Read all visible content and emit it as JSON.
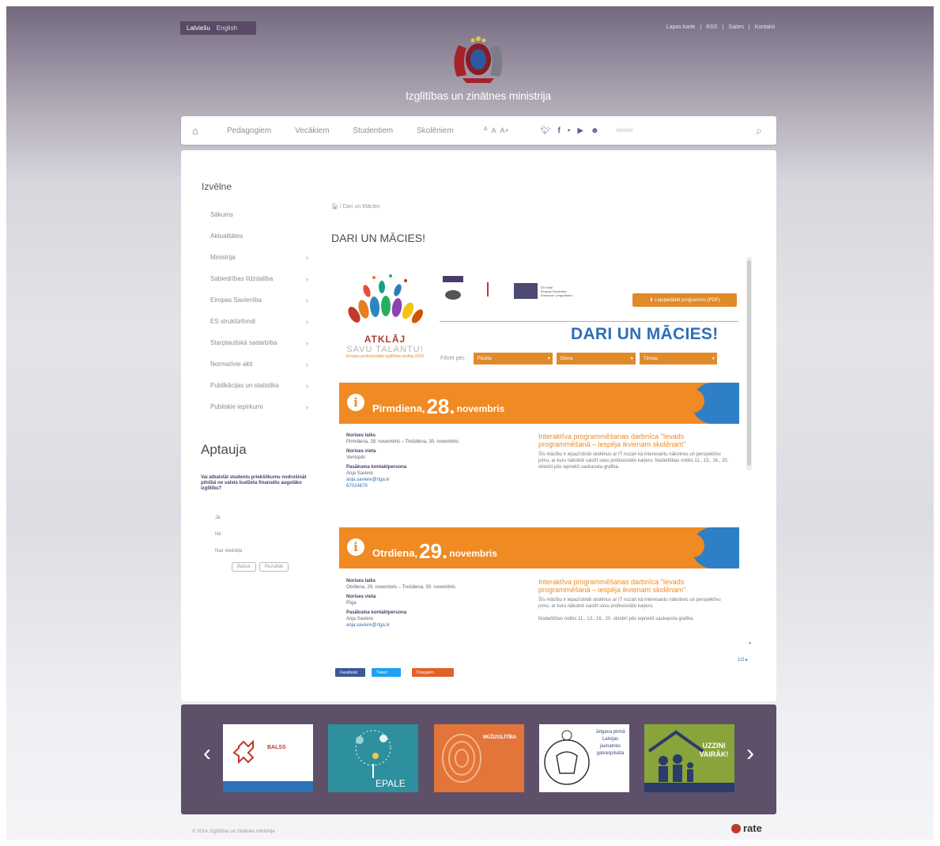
{
  "top": {
    "languages": [
      "Latviešu",
      "English"
    ],
    "links": [
      "Lapas karte",
      "RSS",
      "Saites",
      "Kontakti"
    ],
    "ministry": "Izglītības un zinātnes ministrija"
  },
  "nav": {
    "items": [
      "Pedagogiem",
      "Vecākiem",
      "Studentiem",
      "Skolēniem"
    ],
    "font_sizes": [
      "A",
      "A",
      "A+"
    ],
    "search_placeholder": "Meklēt"
  },
  "sidebar": {
    "title": "Izvēlne",
    "items": [
      {
        "label": "Sākums",
        "has_children": false
      },
      {
        "label": "Aktualitātes",
        "has_children": false
      },
      {
        "label": "Ministrija",
        "has_children": true
      },
      {
        "label": "Sabiedrības līdzdalība",
        "has_children": true
      },
      {
        "label": "Eiropas Savienība",
        "has_children": true
      },
      {
        "label": "ES struktūrfondi",
        "has_children": true
      },
      {
        "label": "Starptautiskā sadarbība",
        "has_children": true
      },
      {
        "label": "Normatīvie akti",
        "has_children": true
      },
      {
        "label": "Publikācijas un statistika",
        "has_children": true
      },
      {
        "label": "Publiskie iepirkumi",
        "has_children": true
      }
    ]
  },
  "poll": {
    "title": "Aptauja",
    "question": "Vai atbalstāt studentu priekšlikumu nodrošināt pilnībā no valsts budžeta finansētu augstāko izglītību?",
    "options": [
      "Jā",
      "Nē",
      "Nav viedokļa"
    ],
    "vote_label": "Balsot",
    "results_label": "Rezultāti"
  },
  "content": {
    "breadcrumb": "/ Dari un Mācies",
    "title": "DARI UN MĀCIES!",
    "banner": {
      "headline": "DARI UN MĀCIES!",
      "slogan_1": "ATKLĀJ",
      "slogan_2": "SAVU TALANTU!",
      "slogan_3": "Eiropas profesionālās izglītības nedēļa 2016",
      "button": "Lejupielādēt programmu (PDF)",
      "filter_label": "Filtrēt pēc",
      "filters": [
        "Pilsēta",
        "Diena",
        "Tēmas"
      ]
    },
    "days": [
      {
        "weekday": "Pirmdiena,",
        "day": "28.",
        "month": "novembris",
        "time_label": "Norises laiks",
        "time": "Pirmdiena, 28. novembris – Trešdiena, 30. novembris",
        "place_label": "Norises vieta",
        "place": "Ventspils",
        "contact_label": "Pasākuma kontaktpersona",
        "contact_name": "Anja Saviere",
        "contact_email": "anja.saviere@rtga.lv",
        "contact_phone": "67024879",
        "event_title": "Interaktīva programmēšanas darbnīca \"Ievads programmēšanā – iespēja ikvienam skolēnam\"",
        "event_desc": "Šīs mācību ir iepazīstināt skolēnus ar IT nozari kā interesantu nākotnes un perspektīvu jomu, ar kuru nākotnē saistīt savu profesionālo karjeru. Nodarbības notiks 11., 13., 16., 20. oktobrī pēc iepriekš saskaņota grafika."
      },
      {
        "weekday": "Otrdiena,",
        "day": "29.",
        "month": "novembris",
        "time_label": "Norises laiks",
        "time": "Otrdiena, 29. novembris – Trešdiena, 30. novembris",
        "place_label": "Norises vieta",
        "place": "Rīga",
        "contact_label": "Pasākuma kontaktpersona",
        "contact_name": "Anja Saviere",
        "contact_email": "anja.saviere@rtga.lv",
        "event_title": "Interaktīva programmēšanas darbnīca \"Ievads programmēšanā – iespēja ikvienam skolēnam\"",
        "event_desc": "Šīs mācību ir iepazīstināt skolēnus ar IT nozari kā interesantu nākotnes un perspektīvu jomu, ar kuru nākotnē saistīt savu profesionālo karjeru.",
        "event_desc_2": "Nodarbības notiks 11., 13., 16., 20. oktobrī pēc iepriekš saskaņota grafika."
      }
    ],
    "page_indicator": "1/2 ▸",
    "share": [
      "Facebook",
      "Tweet",
      "Draugiem"
    ]
  },
  "carousel": {
    "tiles": [
      "BALSS",
      "EPALE",
      "MŪŽIZGLĪTĪBA",
      "Jelgava pirmā Latvijas jaunatnes galvaspilsēta",
      "UZZINI VAIRĀK!"
    ]
  },
  "footer": {
    "copyright": "© 2014, Izglītības un zinātnes ministrija",
    "brand": "rate"
  },
  "colors": {
    "accent": "#f08a23",
    "purple": "#5e5068",
    "blue": "#2e6fb8"
  }
}
